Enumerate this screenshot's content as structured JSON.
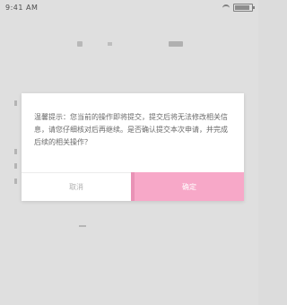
{
  "status_bar": {
    "time": "9:41 AM",
    "wifi_icon": "wifi-icon",
    "battery_icon": "battery-icon"
  },
  "background_page": {
    "top_bar_icons": [
      "back-icon",
      "title-placeholder",
      "action-icon"
    ]
  },
  "dialog": {
    "message": "温馨提示：您当前的操作即将提交，提交后将无法修改相关信息，请您仔细核对后再继续。是否确认提交本次申请，并完成后续的相关操作？",
    "cancel_label": "取消",
    "confirm_label": "确定",
    "colors": {
      "confirm_bg": "#f7a8c8",
      "confirm_border": "#e992b6",
      "cancel_text": "#b0b0b0"
    }
  }
}
